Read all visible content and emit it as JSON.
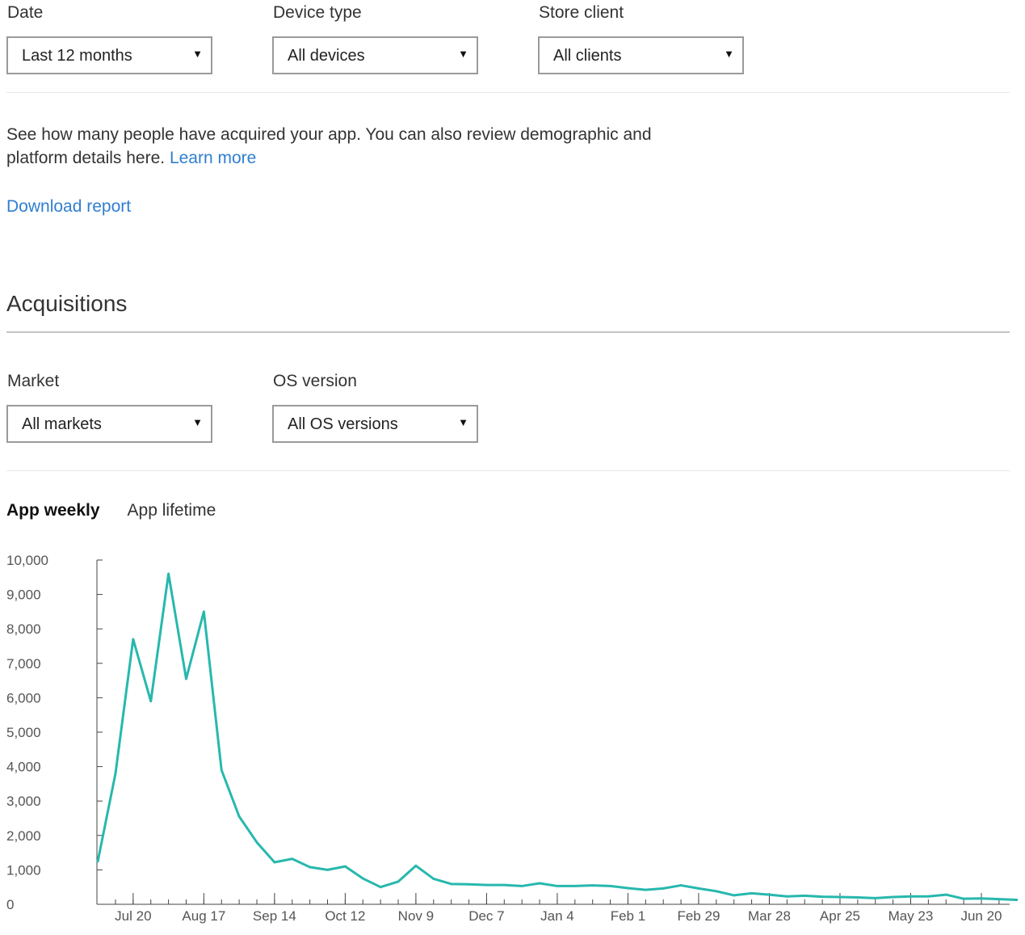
{
  "filters_top": {
    "date": {
      "label": "Date",
      "value": "Last 12 months"
    },
    "device_type": {
      "label": "Device type",
      "value": "All devices"
    },
    "store_client": {
      "label": "Store client",
      "value": "All clients"
    }
  },
  "description": {
    "text": "See how many people have acquired your app. You can also review demographic and platform details here.",
    "learn_more": "Learn more"
  },
  "download_report": "Download report",
  "section_title": "Acquisitions",
  "filters_section": {
    "market": {
      "label": "Market",
      "value": "All markets"
    },
    "os_version": {
      "label": "OS version",
      "value": "All OS versions"
    }
  },
  "tabs": [
    {
      "label": "App weekly",
      "active": true
    },
    {
      "label": "App lifetime",
      "active": false
    }
  ],
  "icons": {
    "dropdown_arrow": "triangle-down-icon"
  },
  "colors": {
    "line": "#27b8ad",
    "link": "#2f7fd0"
  },
  "chart_data": {
    "type": "line",
    "title": "",
    "xlabel": "",
    "ylabel": "",
    "ylim": [
      0,
      10000
    ],
    "yticks": [
      0,
      1000,
      2000,
      3000,
      4000,
      5000,
      6000,
      7000,
      8000,
      9000,
      10000
    ],
    "ytick_labels": [
      "0",
      "1,000",
      "2,000",
      "3,000",
      "4,000",
      "5,000",
      "6,000",
      "7,000",
      "8,000",
      "9,000",
      "10,000"
    ],
    "xtick_labels": [
      "Jul 20",
      "Aug 17",
      "Sep 14",
      "Oct 12",
      "Nov 9",
      "Dec 7",
      "Jan 4",
      "Feb 1",
      "Feb 29",
      "Mar 28",
      "Apr 25",
      "May 23",
      "Jun 20"
    ],
    "xtick_weeks": [
      1,
      5,
      9,
      13,
      17,
      21,
      25,
      29,
      33,
      37,
      41,
      45,
      49
    ],
    "x_range_weeks": [
      -1.05,
      50.6
    ],
    "grid": false,
    "legend": "none",
    "series": [
      {
        "values": [
          1250,
          3800,
          7700,
          5900,
          9600,
          6550,
          8500,
          3900,
          2550,
          1800,
          1220,
          1320,
          1080,
          1000,
          1100,
          750,
          500,
          660,
          1120,
          740,
          590,
          580,
          560,
          560,
          530,
          610,
          530,
          530,
          550,
          530,
          470,
          420,
          460,
          550,
          460,
          380,
          260,
          320,
          280,
          230,
          250,
          220,
          210,
          200,
          180,
          210,
          230,
          230,
          280,
          160,
          170,
          150,
          130
        ]
      }
    ]
  }
}
